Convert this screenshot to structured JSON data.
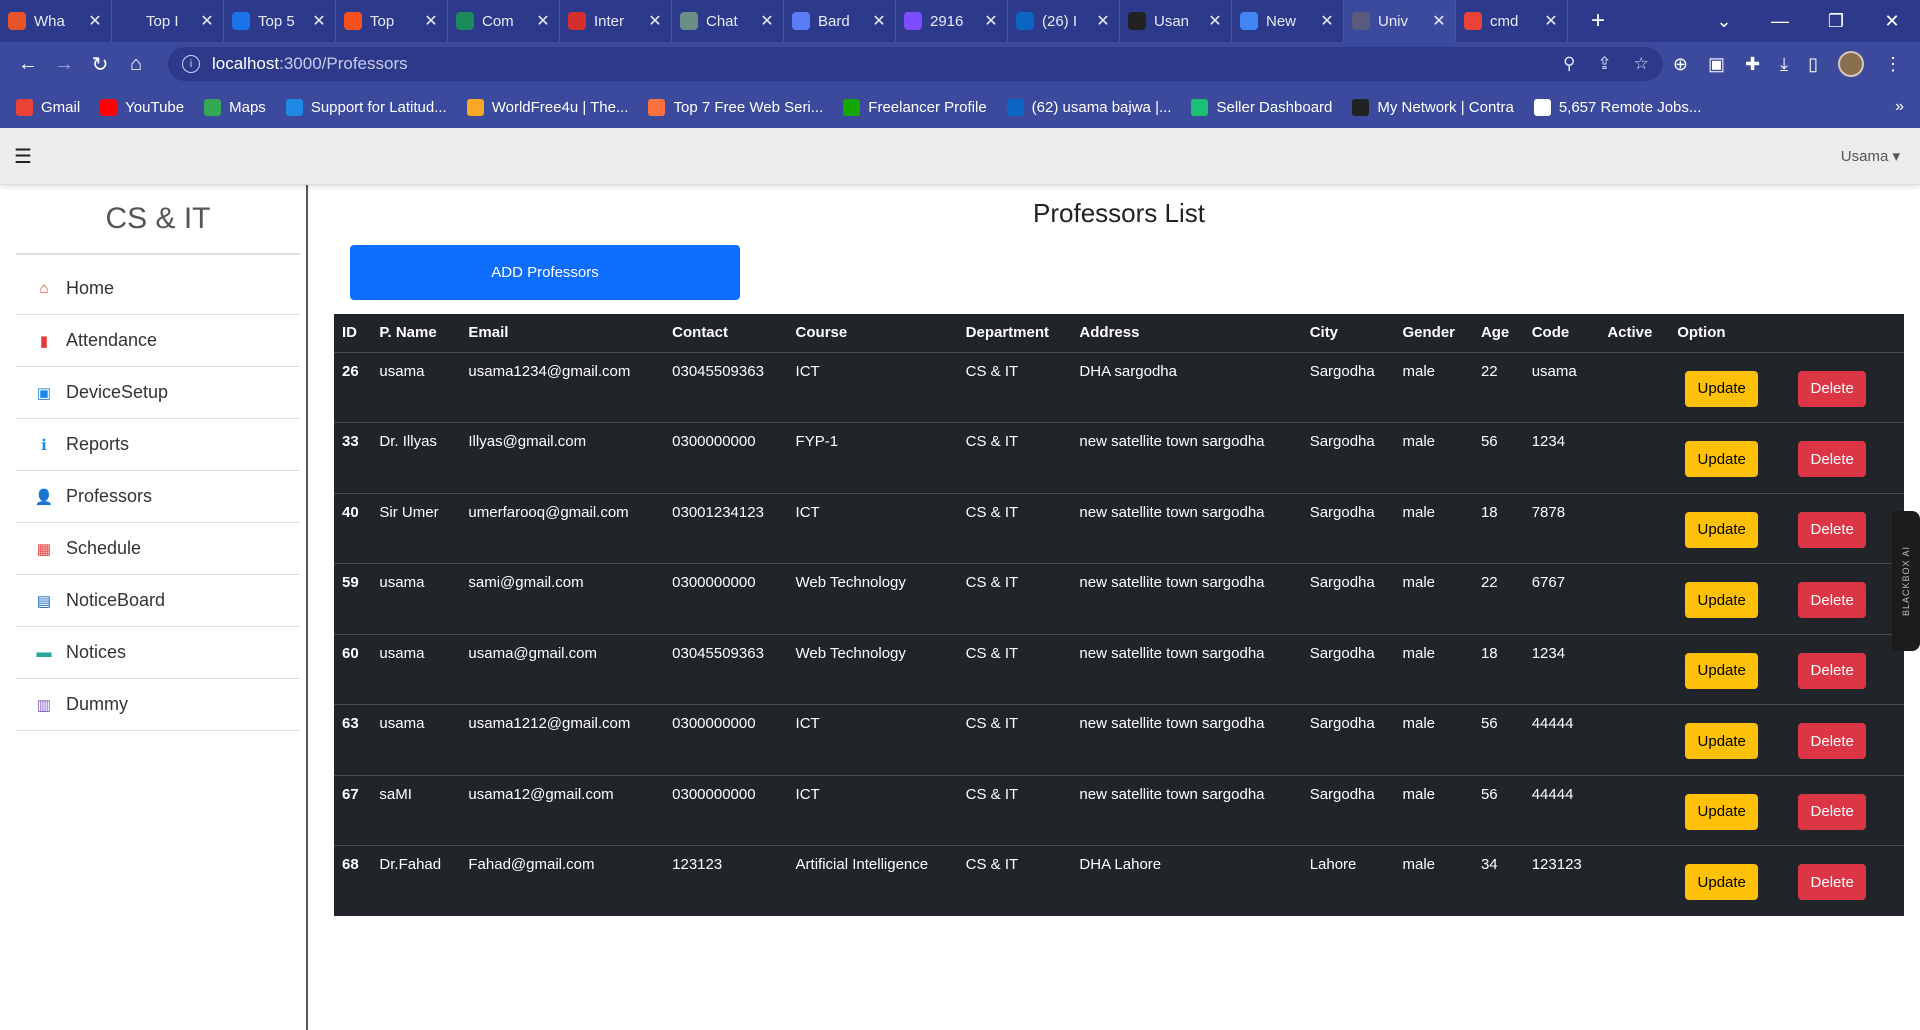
{
  "browser": {
    "tabs": [
      {
        "label": "Wha",
        "icon": "whatsapp-icon",
        "color": "#e8542a"
      },
      {
        "label": "Top I",
        "icon": "globe-icon",
        "color": "#2d3a8c"
      },
      {
        "label": "Top 5",
        "icon": "bookmark-icon",
        "color": "#1a73e8"
      },
      {
        "label": "Top",
        "icon": "ring-icon",
        "color": "#f4511e"
      },
      {
        "label": "Com",
        "icon": "link-icon",
        "color": "#1b8a5a"
      },
      {
        "label": "Inter",
        "icon": "star-icon",
        "color": "#d32f2f"
      },
      {
        "label": "Chat",
        "icon": "chatgpt-icon",
        "color": "#6b8f86"
      },
      {
        "label": "Bard",
        "icon": "sparkle-icon",
        "color": "#5b7cf7"
      },
      {
        "label": "2916",
        "icon": "circle-icon",
        "color": "#7c4dff"
      },
      {
        "label": "(26) I",
        "icon": "linkedin-icon",
        "color": "#0a66c2"
      },
      {
        "label": "Usan",
        "icon": "github-icon",
        "color": "#222222"
      },
      {
        "label": "New",
        "icon": "chrome-icon",
        "color": "#4285f4"
      },
      {
        "label": "Univ",
        "icon": "globe-icon",
        "color": "#5a5a7a",
        "active": true
      },
      {
        "label": "cmd",
        "icon": "google-icon",
        "color": "#ea4335"
      }
    ],
    "url_host": "localhost",
    "url_path": ":3000/Professors",
    "bookmarks": [
      {
        "label": "Gmail",
        "icon": "gmail-icon",
        "color": "#ea4335"
      },
      {
        "label": "YouTube",
        "icon": "youtube-icon",
        "color": "#ff0000"
      },
      {
        "label": "Maps",
        "icon": "maps-icon",
        "color": "#34a853"
      },
      {
        "label": "Support for Latitud...",
        "icon": "dell-icon",
        "color": "#1e88e5"
      },
      {
        "label": "WorldFree4u | The...",
        "icon": "dots-icon",
        "color": "#f9a825"
      },
      {
        "label": "Top 7 Free Web Seri...",
        "icon": "firefox-icon",
        "color": "#ff7043"
      },
      {
        "label": "Freelancer Profile",
        "icon": "upwork-icon",
        "color": "#14a800"
      },
      {
        "label": "(62) usama bajwa |...",
        "icon": "linkedin-icon",
        "color": "#0a66c2"
      },
      {
        "label": "Seller Dashboard",
        "icon": "fiverr-icon",
        "color": "#1dbf73"
      },
      {
        "label": "My Network | Contra",
        "icon": "contra-icon",
        "color": "#222222"
      },
      {
        "label": "5,657 Remote Jobs...",
        "icon": "remote-icon",
        "color": "#ffffff"
      }
    ],
    "more_label": "»"
  },
  "app": {
    "user_label": "Usama ▾",
    "brand": "CS & IT",
    "sidebar": [
      {
        "label": "Home",
        "icon": "home-icon",
        "glyph": "⌂",
        "color": "#e53935"
      },
      {
        "label": "Attendance",
        "icon": "bookmark-icon",
        "glyph": "▮",
        "color": "#e53935"
      },
      {
        "label": "DeviceSetup",
        "icon": "device-icon",
        "glyph": "▣",
        "color": "#1e88e5"
      },
      {
        "label": "Reports",
        "icon": "info-icon",
        "glyph": "ℹ",
        "color": "#1e88e5"
      },
      {
        "label": "Professors",
        "icon": "person-icon",
        "glyph": "👤",
        "color": "#6d4c41"
      },
      {
        "label": "Schedule",
        "icon": "calendar-icon",
        "glyph": "▦",
        "color": "#e53935"
      },
      {
        "label": "NoticeBoard",
        "icon": "clapper-icon",
        "glyph": "▤",
        "color": "#1565c0"
      },
      {
        "label": "Notices",
        "icon": "chat-icon",
        "glyph": "▬",
        "color": "#26a69a"
      },
      {
        "label": "Dummy",
        "icon": "doc-gear-icon",
        "glyph": "▥",
        "color": "#7e57c2"
      }
    ],
    "page_title": "Professors List",
    "add_button": "ADD Professors",
    "table": {
      "headers": [
        "ID",
        "P. Name",
        "Email",
        "Contact",
        "Course",
        "Department",
        "Address",
        "City",
        "Gender",
        "Age",
        "Code",
        "Active",
        "Option"
      ],
      "rows": [
        {
          "id": "26",
          "name": "usama",
          "email": "usama1234@gmail.com",
          "contact": "03045509363",
          "course": "ICT",
          "dept": "CS & IT",
          "address": "DHA sargodha",
          "city": "Sargodha",
          "gender": "male",
          "age": "22",
          "code": "usama",
          "active": ""
        },
        {
          "id": "33",
          "name": "Dr. Illyas",
          "email": "Illyas@gmail.com",
          "contact": "0300000000",
          "course": "FYP-1",
          "dept": "CS & IT",
          "address": "new satellite town sargodha",
          "city": "Sargodha",
          "gender": "male",
          "age": "56",
          "code": "1234",
          "active": ""
        },
        {
          "id": "40",
          "name": "Sir Umer",
          "email": "umerfarooq@gmail.com",
          "contact": "03001234123",
          "course": "ICT",
          "dept": "CS & IT",
          "address": "new satellite town sargodha",
          "city": "Sargodha",
          "gender": "male",
          "age": "18",
          "code": "7878",
          "active": ""
        },
        {
          "id": "59",
          "name": "usama",
          "email": "sami@gmail.com",
          "contact": "0300000000",
          "course": "Web Technology",
          "dept": "CS & IT",
          "address": "new satellite town sargodha",
          "city": "Sargodha",
          "gender": "male",
          "age": "22",
          "code": "6767",
          "active": ""
        },
        {
          "id": "60",
          "name": "usama",
          "email": "usama@gmail.com",
          "contact": "03045509363",
          "course": "Web Technology",
          "dept": "CS & IT",
          "address": "new satellite town sargodha",
          "city": "Sargodha",
          "gender": "male",
          "age": "18",
          "code": "1234",
          "active": ""
        },
        {
          "id": "63",
          "name": "usama",
          "email": "usama1212@gmail.com",
          "contact": "0300000000",
          "course": "ICT",
          "dept": "CS & IT",
          "address": "new satellite town sargodha",
          "city": "Sargodha",
          "gender": "male",
          "age": "56",
          "code": "44444",
          "active": ""
        },
        {
          "id": "67",
          "name": "saMI",
          "email": "usama12@gmail.com",
          "contact": "0300000000",
          "course": "ICT",
          "dept": "CS & IT",
          "address": "new satellite town sargodha",
          "city": "Sargodha",
          "gender": "male",
          "age": "56",
          "code": "44444",
          "active": ""
        },
        {
          "id": "68",
          "name": "Dr.Fahad",
          "email": "Fahad@gmail.com",
          "contact": "123123",
          "course": "Artificial Intelligence",
          "dept": "CS & IT",
          "address": "DHA Lahore",
          "city": "Lahore",
          "gender": "male",
          "age": "34",
          "code": "123123",
          "active": ""
        }
      ],
      "update_label": "Update",
      "delete_label": "Delete"
    },
    "side_widget_label": "BLACKBOX AI",
    "colors": {
      "primary": "#0d6efd",
      "warning": "#ffc107",
      "danger": "#dc3545",
      "table_dark": "#212529",
      "chrome": "#3c4a9e"
    }
  }
}
